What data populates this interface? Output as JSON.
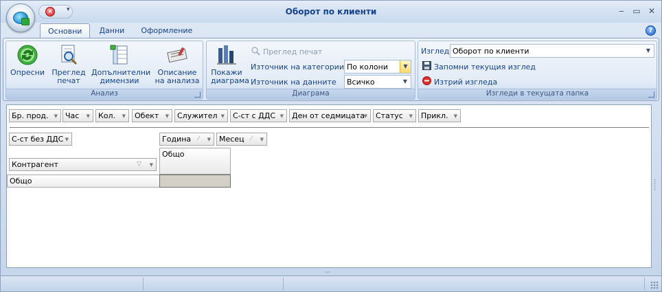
{
  "window": {
    "title": "Оборот по клиенти",
    "minimize_glyph": "‒",
    "maximize_glyph": "▭",
    "close_glyph": "✕"
  },
  "ribbon_tabs": [
    "Основни",
    "Данни",
    "Оформление"
  ],
  "help_glyph": "?",
  "groups": {
    "analysis": {
      "label": "Анализ",
      "buttons": {
        "refresh": [
          "Опресни"
        ],
        "preview": [
          "Преглед",
          "печат"
        ],
        "dimensions": [
          "Допълнителни",
          "димензии"
        ],
        "description": [
          "Описание",
          "на анализа"
        ]
      }
    },
    "chart": {
      "label": "Диаграма",
      "show_chart": [
        "Покажи",
        "диаграма"
      ],
      "print_preview": "Преглед печат",
      "category_source_label": "Източник на категориите",
      "category_source_value": "По колони",
      "data_source_label": "Източник на данните",
      "data_source_value": "Всичко"
    },
    "views": {
      "label": "Изгледи в текущата папка",
      "view_label": "Изглед",
      "view_value": "Оборот по клиенти",
      "save_view": "Запомни текущия изглед",
      "delete_view": "Изтрий изгледа"
    }
  },
  "filter_fields": [
    "Бр. прод.",
    "Час",
    "Кол.",
    "Обект",
    "Служител",
    "С-ст с ДДС",
    "Ден от седмицата",
    "Статус",
    "Прикл."
  ],
  "data_field": "С-ст без ДДС",
  "column_fields": [
    "Година",
    "Месец"
  ],
  "row_field": "Контрагент",
  "column_total": "Общо",
  "row_total": "Общо",
  "splitter_grip": "·····",
  "icons": {
    "qat_close": "close-circle-icon",
    "refresh": "refresh-icon",
    "preview": "print-preview-icon",
    "dimensions": "dimensions-icon",
    "description": "description-icon",
    "chart": "chart-icon",
    "save": "floppy-disk-icon",
    "delete": "delete-icon"
  }
}
